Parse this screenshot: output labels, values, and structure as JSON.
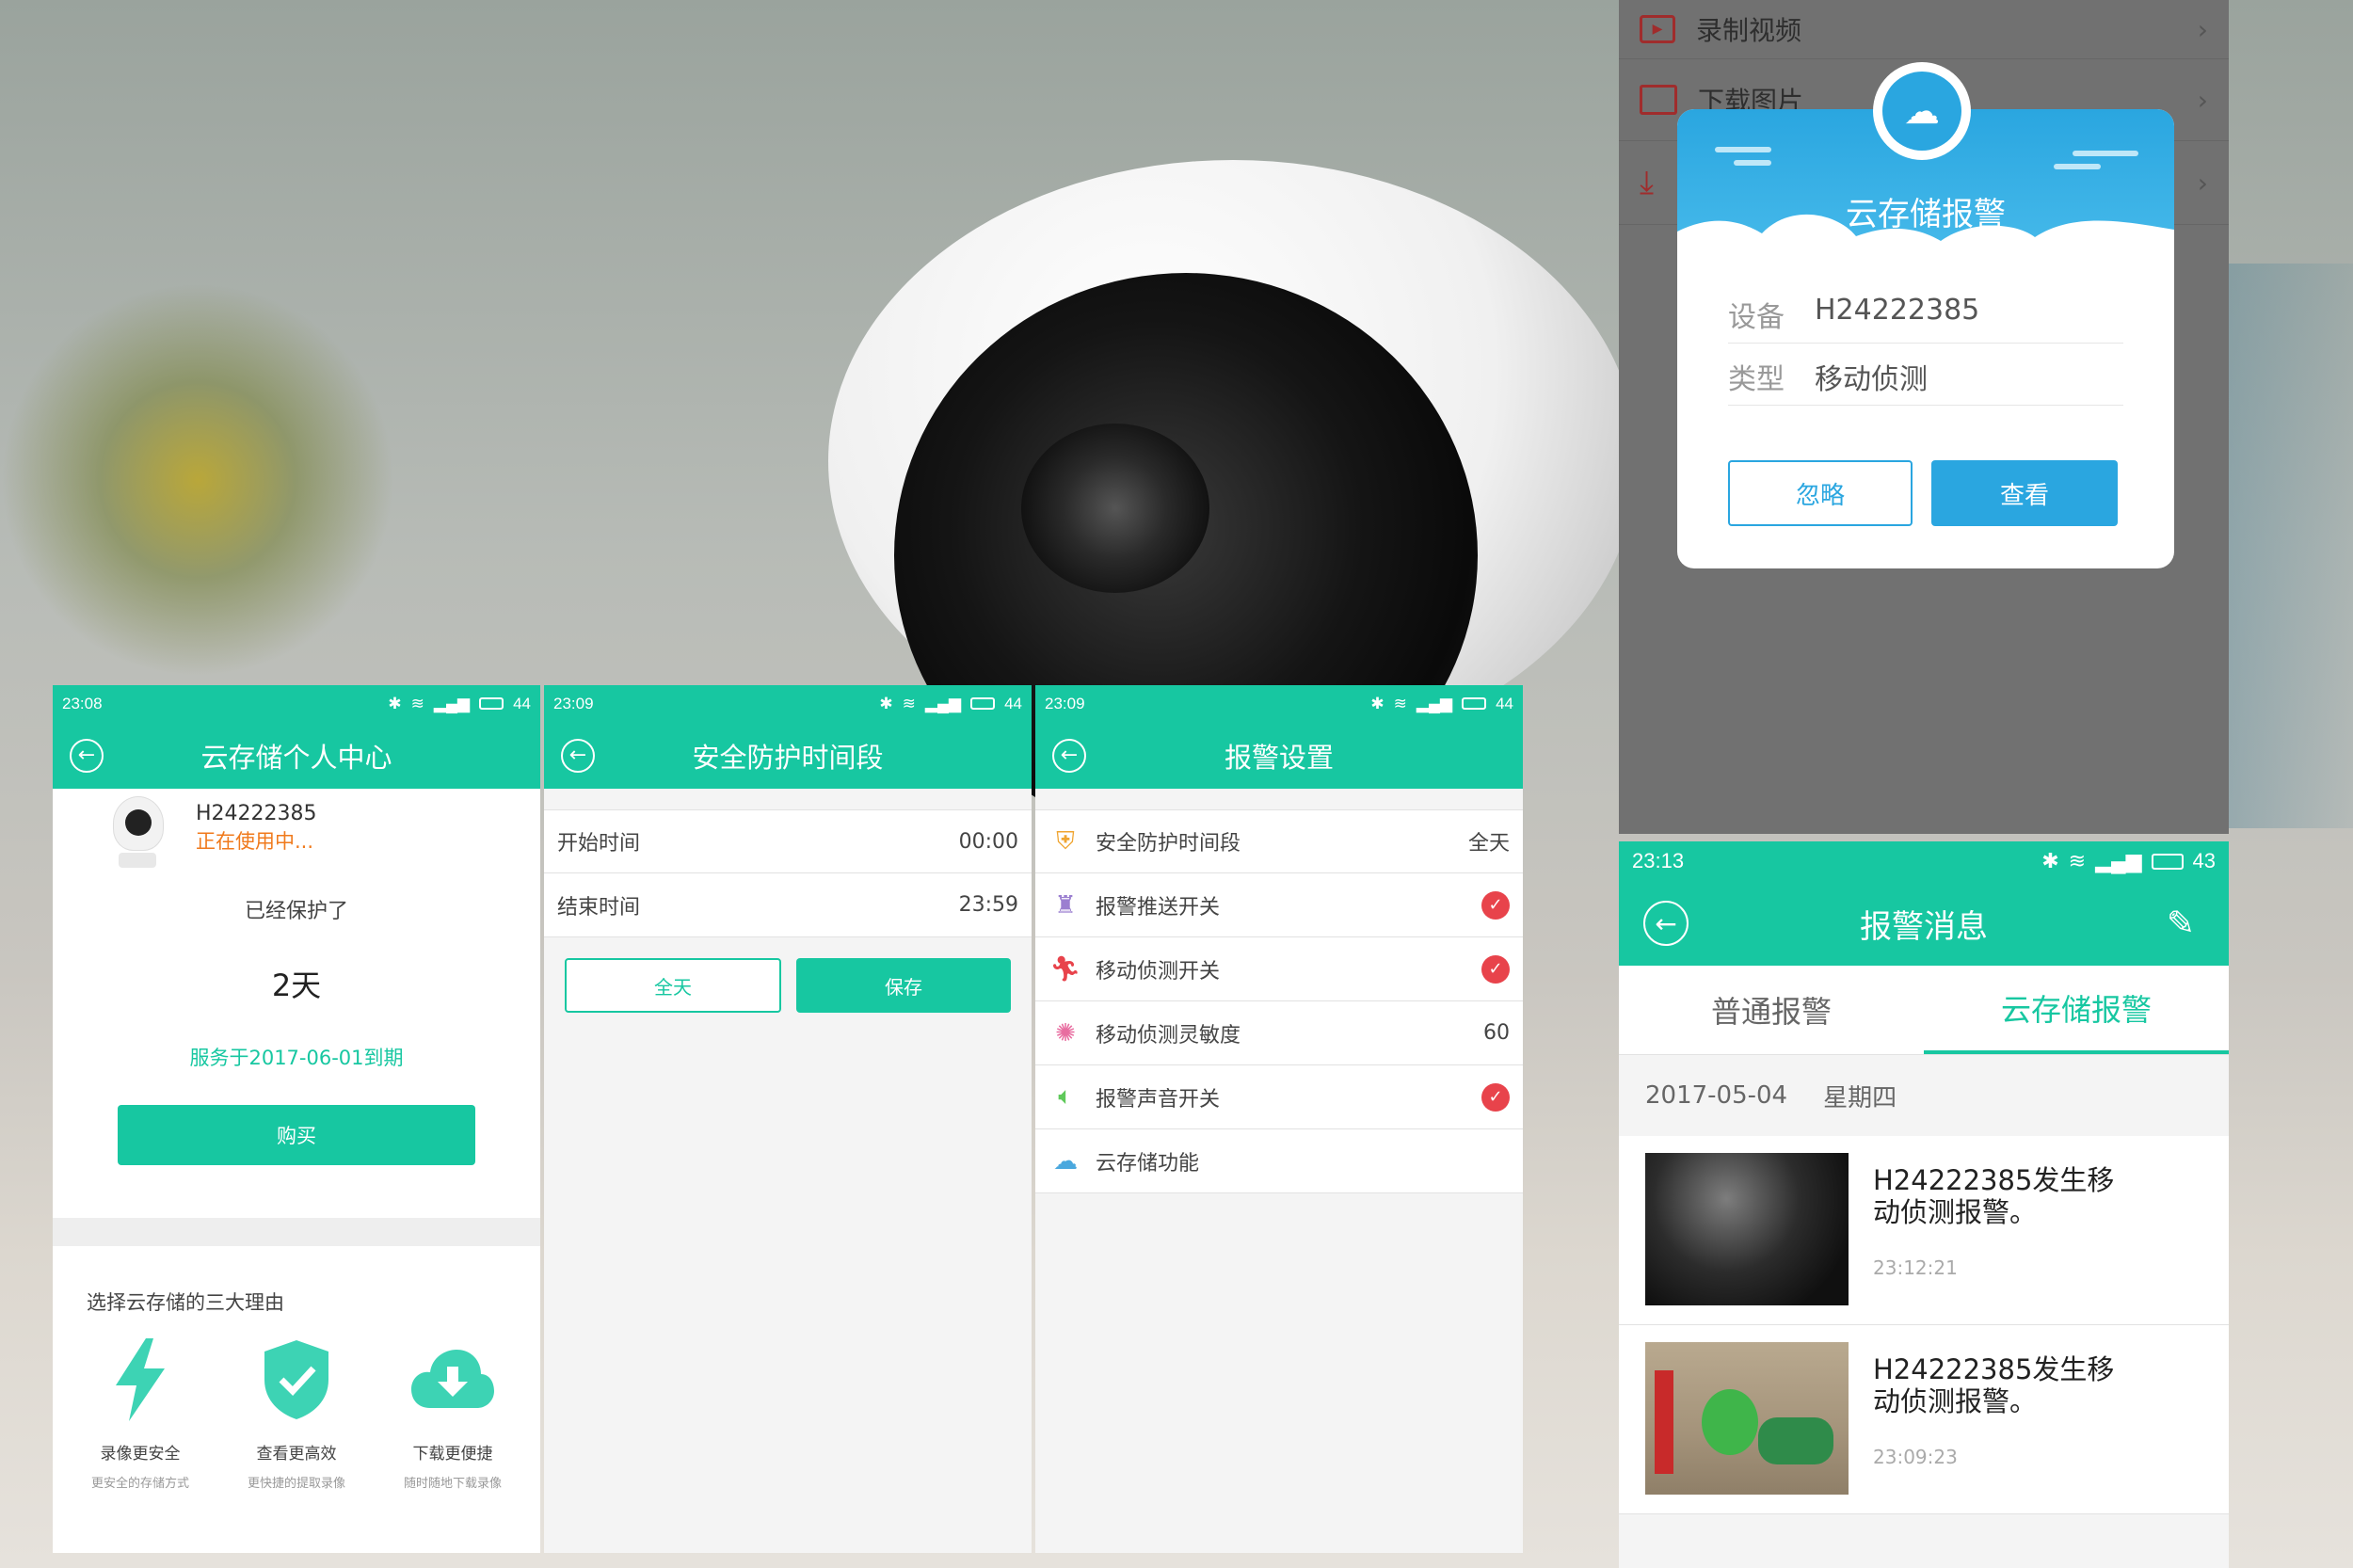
{
  "screen1": {
    "time": "23:08",
    "battery": "44",
    "title": "云存储个人中心",
    "device_name": "H24222385",
    "device_status": "正在使用中...",
    "protected_label": "已经保护了",
    "protected_days": "2天",
    "service_expiry": "服务于2017-06-01到期",
    "buy_label": "购买",
    "reasons_title": "选择云存储的三大理由",
    "reasons": [
      {
        "title": "录像更安全",
        "sub": "更安全的存储方式",
        "icon": "lightning-icon"
      },
      {
        "title": "查看更高效",
        "sub": "更快捷的提取录像",
        "icon": "shield-check-icon"
      },
      {
        "title": "下载更便捷",
        "sub": "随时随地下载录像",
        "icon": "cloud-download-icon"
      }
    ]
  },
  "screen2": {
    "time": "23:09",
    "battery": "44",
    "title": "安全防护时间段",
    "start_label": "开始时间",
    "start_value": "00:00",
    "end_label": "结束时间",
    "end_value": "23:59",
    "allday_label": "全天",
    "save_label": "保存"
  },
  "screen3": {
    "time": "23:09",
    "battery": "44",
    "title": "报警设置",
    "rows": [
      {
        "label": "安全防护时间段",
        "value": "全天",
        "icon": "shield-plus-icon",
        "color": "#f0a531"
      },
      {
        "label": "报警推送开关",
        "toggle": "on",
        "icon": "siren-icon",
        "color": "#9b7fd0"
      },
      {
        "label": "移动侦测开关",
        "toggle": "on",
        "icon": "running-man-icon",
        "color": "#e8434b"
      },
      {
        "label": "移动侦测灵敏度",
        "value": "60",
        "icon": "sensitivity-icon",
        "color": "#e86da0"
      },
      {
        "label": "报警声音开关",
        "toggle": "on",
        "icon": "speaker-icon",
        "color": "#5fc95a"
      },
      {
        "label": "云存储功能",
        "icon": "cloud-icon",
        "color": "#4aa8de"
      }
    ]
  },
  "screen4": {
    "menu": [
      "录制视频",
      "下载图片",
      ""
    ],
    "dialog_title": "云存储报警",
    "device_label": "设备",
    "device_value": "H24222385",
    "type_label": "类型",
    "type_value": "移动侦测",
    "ignore_label": "忽略",
    "view_label": "查看"
  },
  "screen5": {
    "time": "23:13",
    "battery": "43",
    "title": "报警消息",
    "tab_normal": "普通报警",
    "tab_cloud": "云存储报警",
    "date": "2017-05-04",
    "weekday": "星期四",
    "messages": [
      {
        "text": "H24222385发生移动侦测报警。",
        "time": "23:12:21"
      },
      {
        "text": "H24222385发生移动侦测报警。",
        "time": "23:09:23"
      }
    ]
  },
  "colors": {
    "accent": "#17c7a1",
    "dialog_blue": "#2aa6e0",
    "toggle_red": "#e8434b"
  }
}
